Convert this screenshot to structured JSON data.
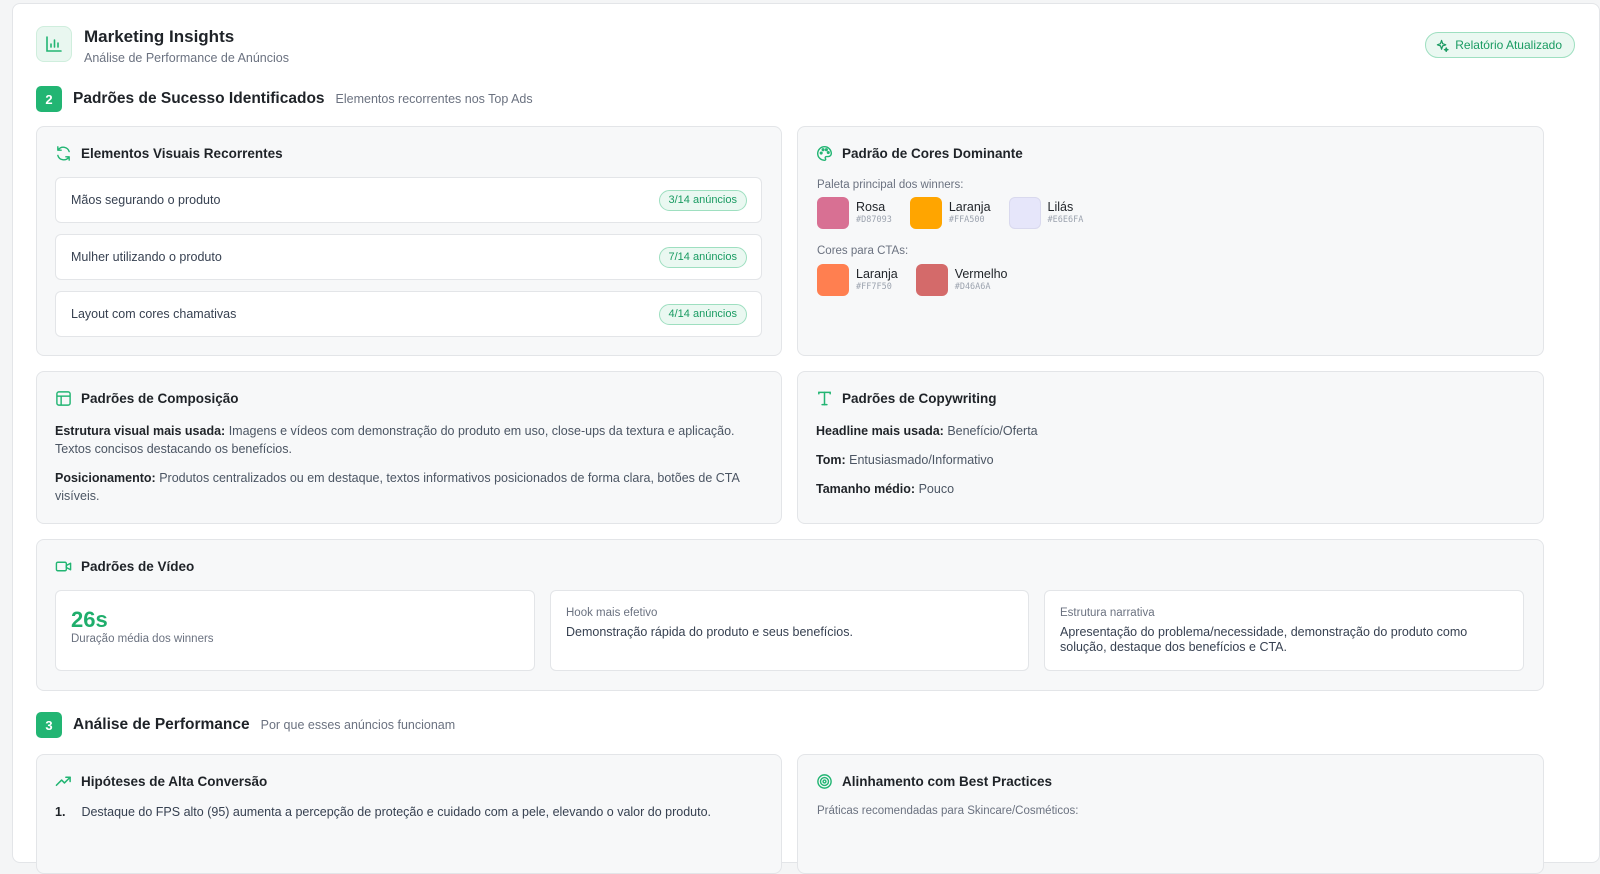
{
  "header": {
    "title": "Marketing Insights",
    "subtitle": "Análise de Performance de Anúncios",
    "badge": "Relatório Atualizado"
  },
  "section2": {
    "number": "2",
    "title": "Padrões de Sucesso Identificados",
    "subtitle": "Elementos recorrentes nos Top Ads"
  },
  "visual_elements": {
    "title": "Elementos Visuais Recorrentes",
    "items": [
      {
        "label": "Mãos segurando o produto",
        "count": "3/14 anúncios"
      },
      {
        "label": "Mulher utilizando o produto",
        "count": "7/14 anúncios"
      },
      {
        "label": "Layout com cores chamativas",
        "count": "4/14 anúncios"
      }
    ]
  },
  "colors": {
    "title": "Padrão de Cores Dominante",
    "palette_label": "Paleta principal dos winners:",
    "palette": [
      {
        "name": "Rosa",
        "hex": "#D87093"
      },
      {
        "name": "Laranja",
        "hex": "#FFA500"
      },
      {
        "name": "Lilás",
        "hex": "#E6E6FA"
      }
    ],
    "cta_label": "Cores para CTAs:",
    "cta": [
      {
        "name": "Laranja",
        "hex": "#FF7F50"
      },
      {
        "name": "Vermelho",
        "hex": "#D46A6A"
      }
    ]
  },
  "composition": {
    "title": "Padrões de Composição",
    "structure_label": "Estrutura visual mais usada:",
    "structure_text": "Imagens e vídeos com demonstração do produto em uso, close-ups da textura e aplicação. Textos concisos destacando os benefícios.",
    "position_label": "Posicionamento:",
    "position_text": "Produtos centralizados ou em destaque, textos informativos posicionados de forma clara, botões de CTA visíveis."
  },
  "copywriting": {
    "title": "Padrões de Copywriting",
    "headline_label": "Headline mais usada:",
    "headline_value": "Benefício/Oferta",
    "tone_label": "Tom:",
    "tone_value": "Entusiasmado/Informativo",
    "size_label": "Tamanho médio:",
    "size_value": "Pouco"
  },
  "video": {
    "title": "Padrões de Vídeo",
    "duration_value": "26s",
    "duration_label": "Duração média dos winners",
    "hook_label": "Hook mais efetivo",
    "hook_text": "Demonstração rápida do produto e seus benefícios.",
    "narrative_label": "Estrutura narrativa",
    "narrative_text": "Apresentação do problema/necessidade, demonstração do produto como solução, destaque dos benefícios e CTA."
  },
  "section3": {
    "number": "3",
    "title": "Análise de Performance",
    "subtitle": "Por que esses anúncios funcionam"
  },
  "hypotheses": {
    "title": "Hipóteses de Alta Conversão",
    "items": [
      {
        "num": "1.",
        "text": "Destaque do FPS alto (95) aumenta a percepção de proteção e cuidado com a pele, elevando o valor do produto."
      }
    ]
  },
  "best_practices": {
    "title": "Alinhamento com Best Practices",
    "subtitle": "Práticas recomendadas para Skincare/Cosméticos:"
  },
  "accent_color": "#22B573"
}
